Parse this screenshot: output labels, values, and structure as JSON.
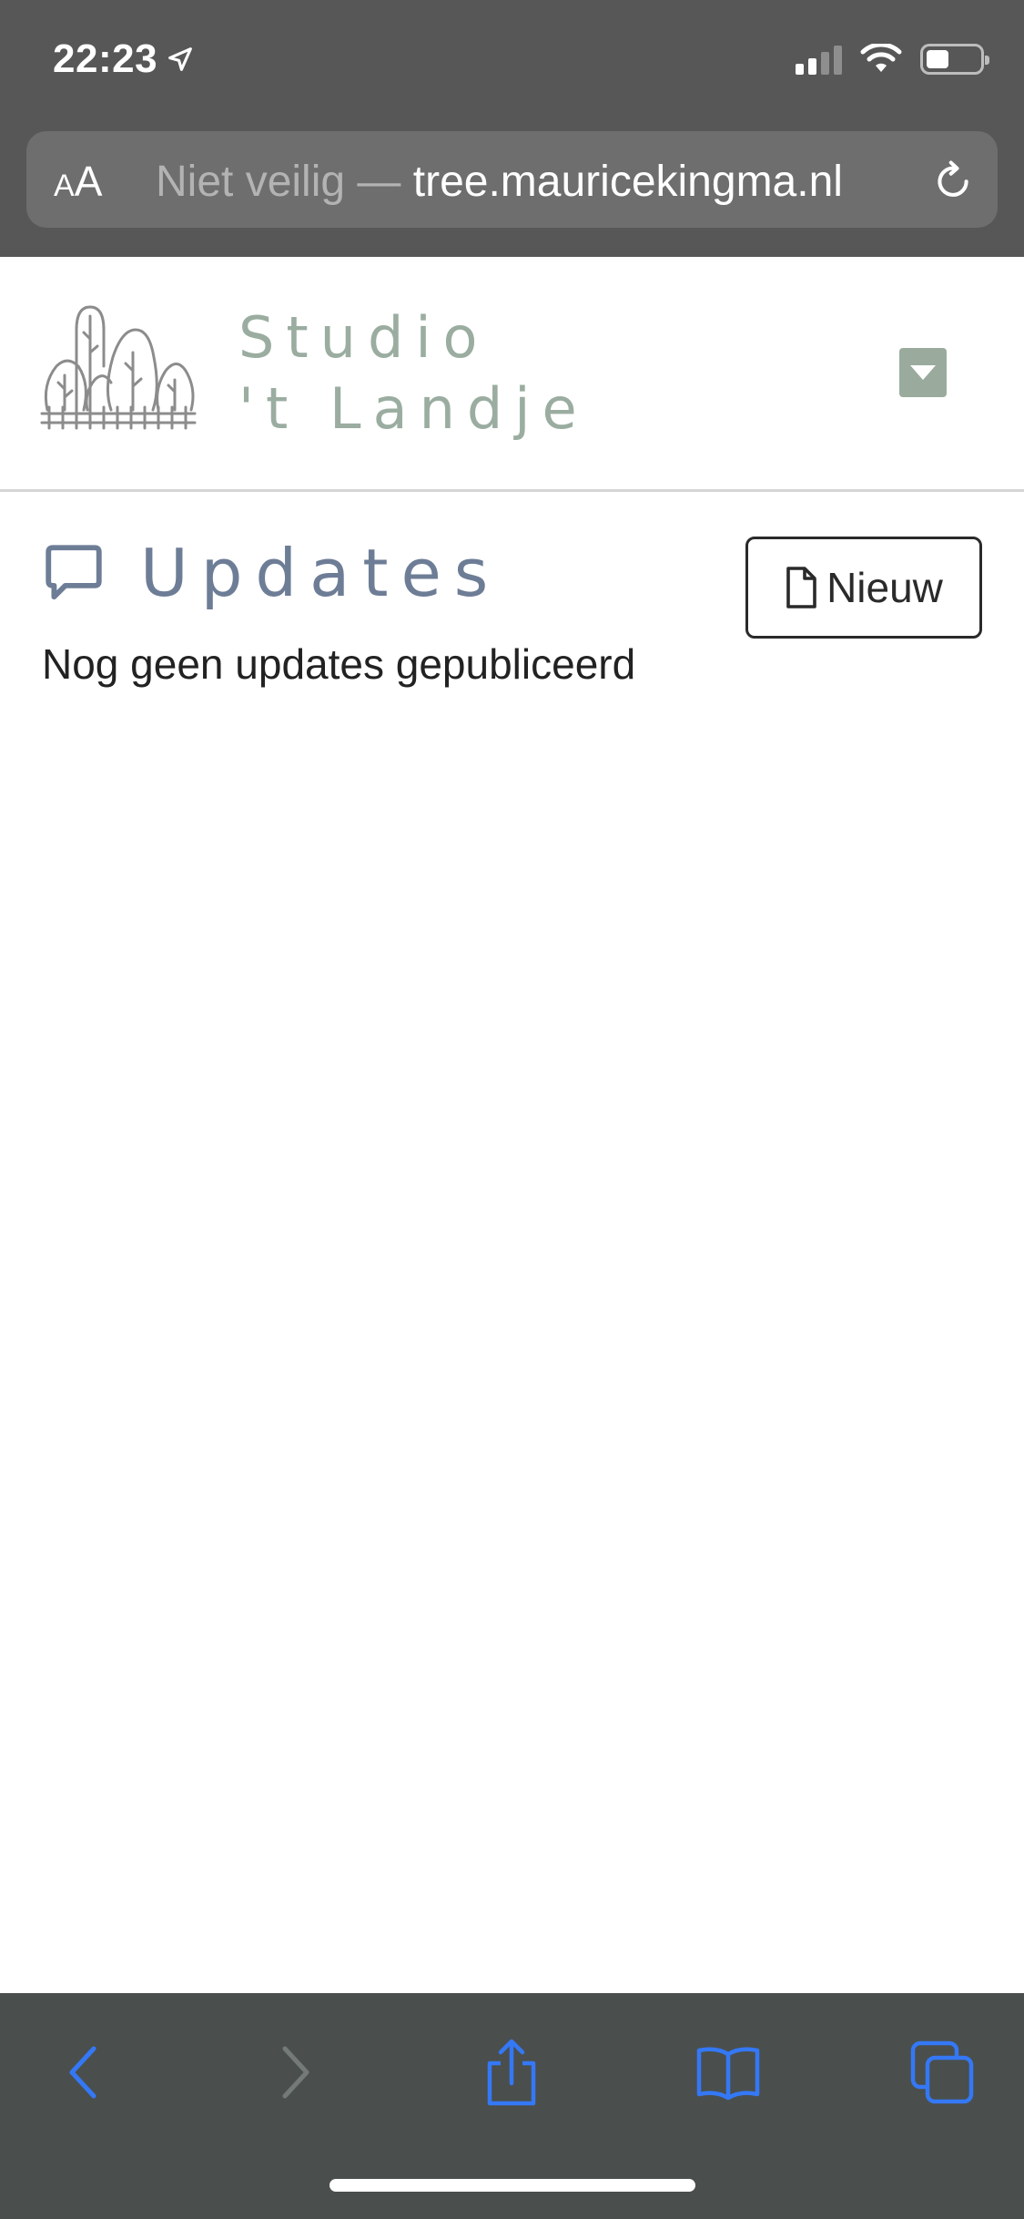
{
  "status_bar": {
    "time": "22:23",
    "icons": [
      "location-arrow-icon",
      "cellular-signal-icon",
      "wifi-icon",
      "battery-icon"
    ]
  },
  "browser": {
    "text_size_label_small": "A",
    "text_size_label_large": "A",
    "url_prefix": "Niet veilig — ",
    "url_host": "tree.mauricekingma.nl",
    "reload_icon": "reload-icon"
  },
  "site": {
    "logo_icon": "trees-logo-icon",
    "brand_line1": "Studio",
    "brand_line2": "'t Landje",
    "brand_color": "#9aada0",
    "menu_icon": "caret-down-icon"
  },
  "page": {
    "title_icon": "chat-bubble-icon",
    "title": "Updates",
    "title_color": "#6e7d96",
    "new_button_icon": "document-icon",
    "new_button_label": "Nieuw",
    "empty_message": "Nog geen updates gepubliceerd"
  },
  "toolbar": {
    "accent_color": "#3478f6",
    "items": [
      "back-icon",
      "forward-icon",
      "share-icon",
      "bookmarks-icon",
      "tabs-icon"
    ]
  }
}
